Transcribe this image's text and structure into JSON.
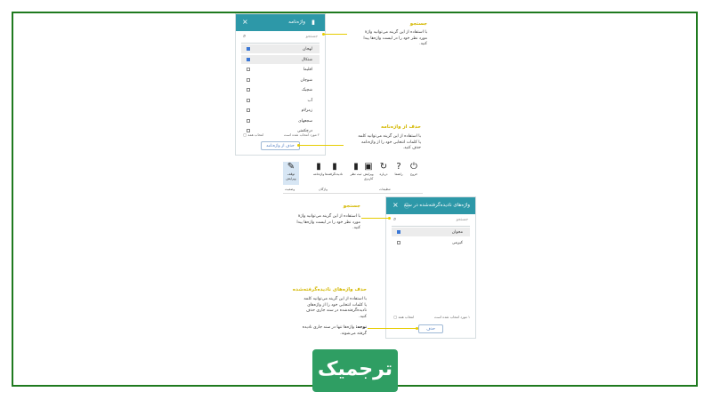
{
  "panel1": {
    "title": "واژه‌نامه",
    "search_placeholder": "جستجو",
    "items": [
      {
        "label": "لهجان",
        "selected": true
      },
      {
        "label": "شتکال",
        "selected": true
      },
      {
        "label": "اقلیما",
        "selected": false
      },
      {
        "label": "شوچان",
        "selected": false
      },
      {
        "label": "شچیک",
        "selected": false
      },
      {
        "label": "آب",
        "selected": false
      },
      {
        "label": "زمزلام",
        "selected": false
      },
      {
        "label": "سجعهای",
        "selected": false
      },
      {
        "label": "درچکمتی",
        "selected": false
      }
    ],
    "footer_count": "۲ مورد انتخاب شده است",
    "footer_select_all": "انتخاب همه",
    "delete_button": "حذف از واژه‌نامه"
  },
  "panel2": {
    "title": "واژه‌های نادیده‌گرفته‌شده در سند",
    "search_placeholder": "جستجو",
    "items": [
      {
        "label": "مجوان",
        "selected": true
      },
      {
        "label": "کیزمی",
        "selected": false
      }
    ],
    "footer_count": "۱ مورد انتخاب شده است",
    "footer_select_all": "انتخاب همه",
    "delete_button": "حذف"
  },
  "annotations": {
    "search1_title": "جستجو",
    "search1_text": [
      "با استفاده از این گزینه می‌توانید واژهٔ",
      "مورد نظر خود را در لیست واژه‌ها پیدا",
      "کنید."
    ],
    "delete1_title": "حذف از واژه‌نامه",
    "delete1_text": [
      "با استفاده از این گزینه می‌توانید کلمه",
      "یا کلمات انتخابی خود را از واژه‌نامه",
      "حذف کنید."
    ],
    "search2_title": "جستجو",
    "search2_text": [
      "با استفاده از این گزینه می‌توانید واژهٔ",
      "مورد نظر خود را در لیست واژه‌ها پیدا",
      "کنید."
    ],
    "delete2_title": "حذف واژه‌های نادیده‌گرفته‌شده",
    "delete2_text": [
      "با استفاده از این گزینه می‌توانید کلمه",
      "یا کلمات انتخابی خود را از واژه‌های",
      "نادیده‌گرفته‌شده در سند جاری حذف",
      "کنید."
    ],
    "note_bold": "توجه:",
    "note_text": [
      "واژه‌ها تنها در سند جاری نادیده",
      "گرفته می‌شوند."
    ]
  },
  "ribbon": {
    "buttons": [
      {
        "label": "خروج",
        "icon": "power-icon",
        "glyph": "⏻"
      },
      {
        "label": "راهنما",
        "icon": "help-icon",
        "glyph": "?"
      },
      {
        "label": "درباره",
        "icon": "about-icon",
        "glyph": "↻"
      },
      {
        "label": "ویرایش کاربری",
        "icon": "user-icon",
        "glyph": "▣"
      },
      {
        "label": "ثبت نظر",
        "icon": "comment-icon",
        "glyph": "▮"
      },
      {
        "label": "نادیده‌گرفته‌ها",
        "icon": "ignored-book-icon",
        "glyph": "▮"
      },
      {
        "label": "واژه‌نامه",
        "icon": "dictionary-icon",
        "glyph": "▮"
      },
      {
        "label": "توقف ویرایش",
        "icon": "edit-stop-icon",
        "glyph": "✎"
      }
    ],
    "groups": [
      "تنظیمات",
      "واژگان",
      "وضعیت"
    ]
  },
  "logo_text": "ترجمیک",
  "colors": {
    "accent": "#2d98a8",
    "highlight": "#e6cc00",
    "border": "#1f7a1f",
    "logo": "#2f9e63"
  }
}
